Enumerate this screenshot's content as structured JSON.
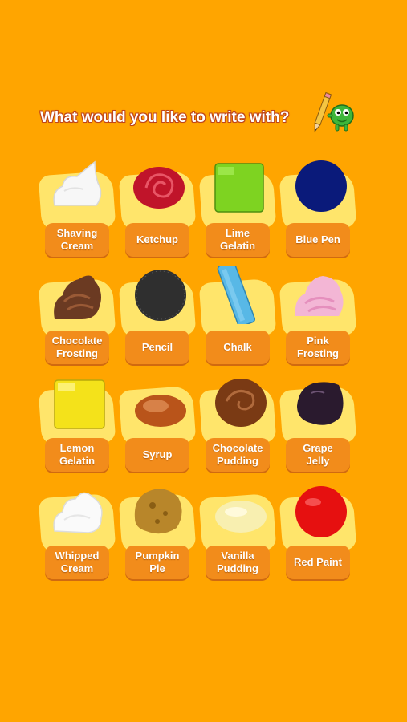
{
  "header": {
    "title": "What would you like to write with?"
  },
  "tiles": [
    {
      "label": "Shaving\nCream",
      "icon": "shaving-cream-swatch",
      "color": "#F5F5F5"
    },
    {
      "label": "Ketchup",
      "icon": "ketchup-swatch",
      "color": "#C0142A"
    },
    {
      "label": "Lime\nGelatin",
      "icon": "lime-gelatin-swatch",
      "color": "#7ED321"
    },
    {
      "label": "Blue Pen",
      "icon": "blue-pen-swatch",
      "color": "#0A1A7A"
    },
    {
      "label": "Chocolate\nFrosting",
      "icon": "chocolate-frosting-swatch",
      "color": "#6B3A22"
    },
    {
      "label": "Pencil",
      "icon": "pencil-swatch",
      "color": "#2F2F2F"
    },
    {
      "label": "Chalk",
      "icon": "chalk-swatch",
      "color": "#58B8E6"
    },
    {
      "label": "Pink\nFrosting",
      "icon": "pink-frosting-swatch",
      "color": "#F3B6D5"
    },
    {
      "label": "Lemon\nGelatin",
      "icon": "lemon-gelatin-swatch",
      "color": "#F4E21A"
    },
    {
      "label": "Syrup",
      "icon": "syrup-swatch",
      "color": "#B9541A"
    },
    {
      "label": "Chocolate\nPudding",
      "icon": "chocolate-pudding-swatch",
      "color": "#7A3A14"
    },
    {
      "label": "Grape\nJelly",
      "icon": "grape-jelly-swatch",
      "color": "#2A1A2E"
    },
    {
      "label": "Whipped\nCream",
      "icon": "whipped-cream-swatch",
      "color": "#FAFAFA"
    },
    {
      "label": "Pumpkin\nPie",
      "icon": "pumpkin-pie-swatch",
      "color": "#B8862A"
    },
    {
      "label": "Vanilla\nPudding",
      "icon": "vanilla-pudding-swatch",
      "color": "#F8EFB0"
    },
    {
      "label": "Red Paint",
      "icon": "red-paint-swatch",
      "color": "#E61010"
    }
  ]
}
